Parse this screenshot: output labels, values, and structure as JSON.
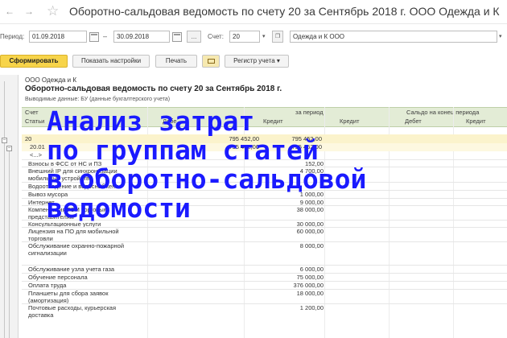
{
  "window": {
    "title": "Оборотно-сальдовая ведомость по счету 20 за Сентябрь 2018 г. ООО Одежда и К",
    "back_icon": "arrow-left-icon",
    "forward_icon": "arrow-right-icon",
    "favorite_icon": "star-icon"
  },
  "params": {
    "period_label": "Период:",
    "date_from": "01.09.2018",
    "dash": "–",
    "date_to": "30.09.2018",
    "dots": "...",
    "account_label": "Счет:",
    "account_value": "20",
    "org_value": "Одежда и К ООО"
  },
  "toolbar": {
    "generate_label": "Сформировать",
    "settings_label": "Показать настройки",
    "print_label": "Печать",
    "register_label": "Регистр учета",
    "register_arrow": "▾"
  },
  "report": {
    "org_name": "ООО Одежда и К",
    "title": "Оборотно-сальдовая ведомость по счету 20 за Сентябрь 2018 г.",
    "subtitle": "Выводимые данные:  БУ (данные бухгалтерского учета)",
    "header": {
      "account": "Счет",
      "articles": "Статьи",
      "debit_partial": "Дебе",
      "turnover_partial": "за период",
      "balance_end": "Сальдо на конец периода",
      "credit": "Кредит",
      "debit": "Дебет",
      "credit_2": "Кредит",
      "debit_2": "Дебет",
      "credit_3": "Кредит"
    },
    "group_row": {
      "account": "20",
      "debit": "795 452,00",
      "credit": "795 452,00"
    },
    "sub_row": {
      "account": "20.01",
      "debit": "795 452,00",
      "credit": "795 452,00"
    },
    "placeholder_row": "<...>",
    "rows": [
      {
        "name": "Взносы в ФСС от НС и ПЗ",
        "value": "152,00"
      },
      {
        "name": "Внешний IP для синхронизации мобильных устройств",
        "value": "4 700,00"
      },
      {
        "name": "Водоотведение и водоснабжение",
        "value": ""
      },
      {
        "name": "Вывоз мусора",
        "value": "1 000,00"
      },
      {
        "name": "Интернет",
        "value": "9 000,00"
      },
      {
        "name": "Компенсация ГСМ торговым представителям",
        "value": "38 000,00"
      },
      {
        "name": "Консультационные услуги",
        "value": "30 000,00"
      },
      {
        "name": "Лицензия на ПО для мобильной торговли",
        "value": "60 000,00"
      },
      {
        "name": "Обслуживание охранно-пожарной сигнализации",
        "value": "8 000,00"
      },
      {
        "name": "Обслуживание узла учета газа",
        "value": "6 000,00"
      },
      {
        "name": "Обучение персонала",
        "value": "75 000,00"
      },
      {
        "name": "Оплата труда",
        "value": "376 000,00"
      },
      {
        "name": "Планшеты для сбора заявок (амортизация)",
        "value": "18 000,00"
      },
      {
        "name": "Почтовые расходы, курьерская доставка",
        "value": "1 200,00"
      }
    ]
  },
  "overlay": {
    "line1": "Анализ затрат",
    "line2": "по группам статей",
    "line3": "в оборотно-сальдовой",
    "line4": "ведомости",
    "color": "#1a1aff"
  }
}
